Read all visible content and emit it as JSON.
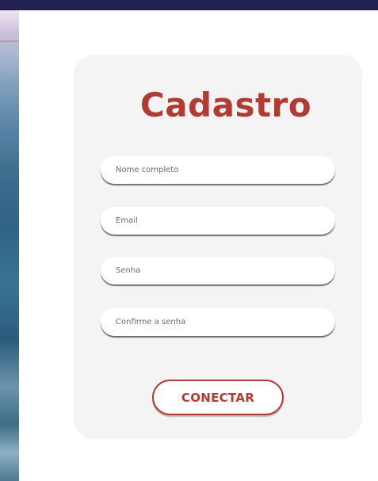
{
  "form": {
    "title": "Cadastro",
    "fields": [
      {
        "placeholder": "Nome completo",
        "value": ""
      },
      {
        "placeholder": "Email",
        "value": ""
      },
      {
        "placeholder": "Senha",
        "value": ""
      },
      {
        "placeholder": "Confirme a senha",
        "value": ""
      }
    ],
    "submit_label": "CONECTAR"
  },
  "colors": {
    "accent": "#b13b33",
    "top_bar": "#23214f",
    "card_bg": "#f4f4f4"
  }
}
